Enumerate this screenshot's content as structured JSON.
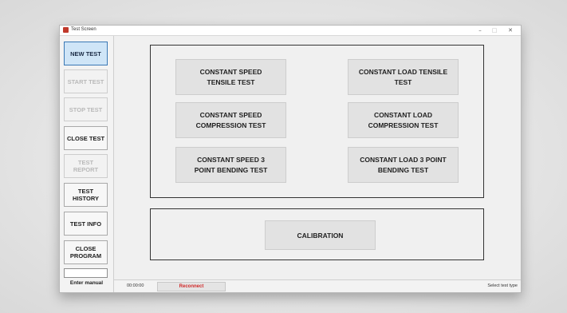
{
  "window": {
    "title": "Test Screen",
    "controls": {
      "minimize": "–",
      "maximize": "□",
      "close": "✕"
    }
  },
  "sidebar": {
    "new_test": "NEW TEST",
    "start_test": "START TEST",
    "stop_test": "STOP TEST",
    "close_test": "CLOSE TEST",
    "test_report": "TEST REPORT",
    "test_history": "TEST HISTORY",
    "test_info": "TEST INFO",
    "close_program": "CLOSE PROGRAM",
    "manual_input_value": "",
    "manual_label": "Enter manual"
  },
  "tests": {
    "cs_tensile": "CONSTANT SPEED TENSILE TEST",
    "cl_tensile": "CONSTANT LOAD TENSILE TEST",
    "cs_compression": "CONSTANT SPEED COMPRESSION TEST",
    "cl_compression": "CONSTANT LOAD COMPRESSION TEST",
    "cs_bending": "CONSTANT SPEED 3 POINT BENDING TEST",
    "cl_bending": "CONSTANT LOAD 3 POINT BENDING TEST"
  },
  "calibration": {
    "label": "CALIBRATION"
  },
  "status": {
    "time": "00:00:00",
    "reconnect": "Reconnect",
    "message": "Select test type"
  },
  "colors": {
    "active_button": "#cfe5f7",
    "reconnect_text": "#d12a2a",
    "app_icon": "#c0392b"
  }
}
